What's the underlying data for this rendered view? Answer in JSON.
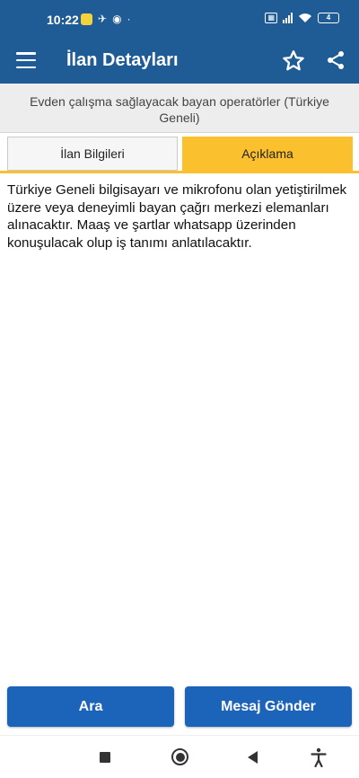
{
  "status": {
    "time": "10:22",
    "battery": "4"
  },
  "header": {
    "title": "İlan Detayları",
    "icons": [
      "menu-icon",
      "star-icon",
      "share-icon"
    ]
  },
  "listing": {
    "title": "Evden çalışma sağlayacak bayan operatörler (Türkiye Geneli)",
    "description": "Türkiye Geneli bilgisayarı ve mikrofonu olan yetiştirilmek üzere veya deneyimli bayan çağrı merkezi elemanları alınacaktır. Maaş ve şartlar whatsapp üzerinden konuşulacak olup iş tanımı anlatılacaktır."
  },
  "tabs": [
    {
      "label": "İlan Bilgileri",
      "active": false
    },
    {
      "label": "Açıklama",
      "active": true
    }
  ],
  "actions": {
    "call_label": "Ara",
    "message_label": "Mesaj Gönder"
  },
  "colors": {
    "header": "#1f5b94",
    "tab_active": "#fbc02d",
    "button": "#1c63ba"
  }
}
